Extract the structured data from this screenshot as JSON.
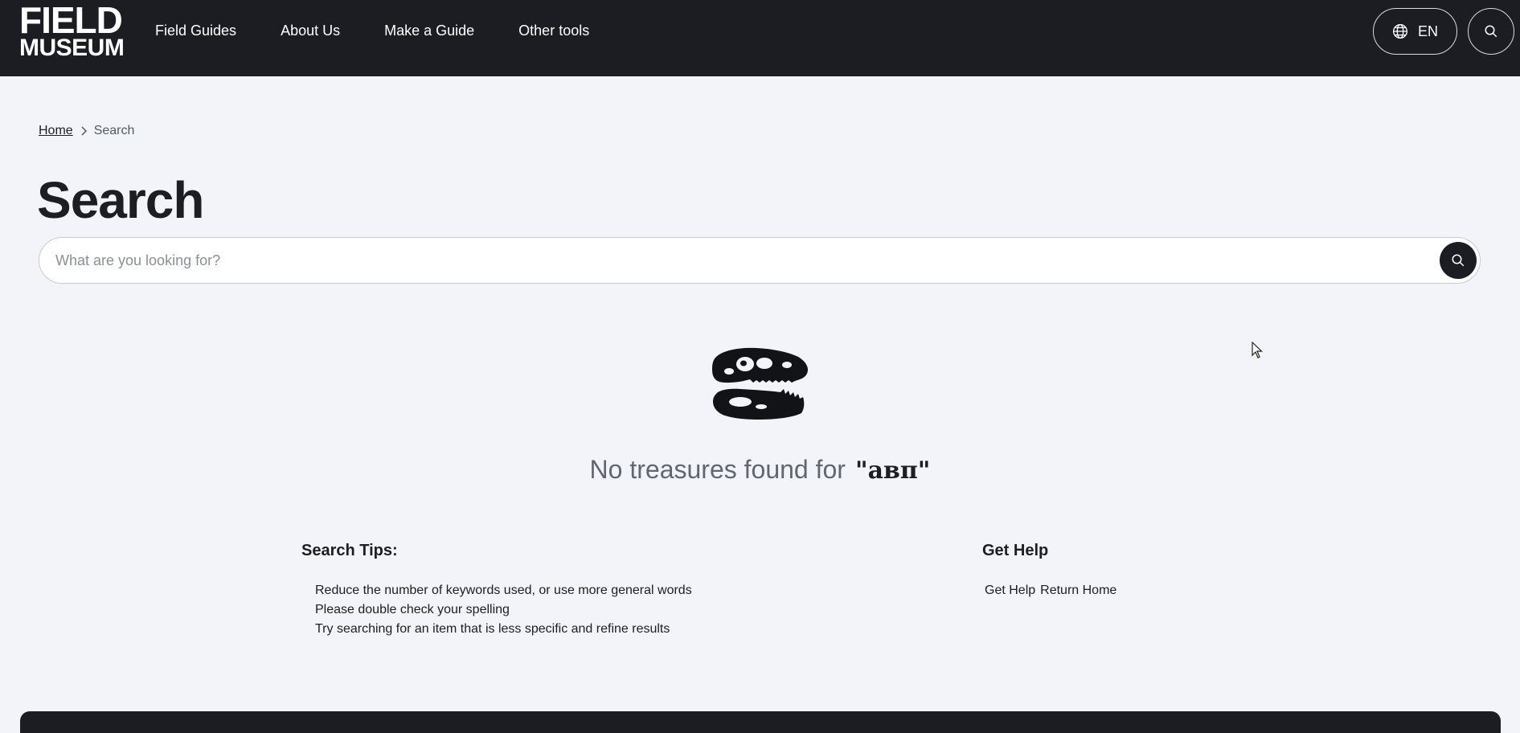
{
  "header": {
    "logo": {
      "line1": "FIELD",
      "line2": "MUSEUM"
    },
    "nav": [
      {
        "label": "Field Guides"
      },
      {
        "label": "About Us"
      },
      {
        "label": "Make a Guide"
      },
      {
        "label": "Other tools"
      }
    ],
    "language": {
      "label": "EN",
      "icon": "globe-icon"
    },
    "search_icon": "search-icon"
  },
  "breadcrumb": {
    "home": "Home",
    "current": "Search"
  },
  "page": {
    "title": "Search",
    "search": {
      "placeholder": "What are you looking for?",
      "value": ""
    }
  },
  "results": {
    "illustration": "dinosaur-skull-icon",
    "message": "No treasures found for",
    "query": "\"авп\""
  },
  "tips": {
    "title": "Search Tips:",
    "items": [
      "Reduce the number of keywords used, or use more general words",
      "Please double check your spelling",
      "Try searching for an item that is less specific and refine results"
    ]
  },
  "help": {
    "title": "Get Help",
    "links": [
      "Get Help",
      "Return Home"
    ]
  },
  "colors": {
    "header_bg": "#1c1d22",
    "page_bg": "#f2f4f9",
    "text": "#1d1e22"
  }
}
